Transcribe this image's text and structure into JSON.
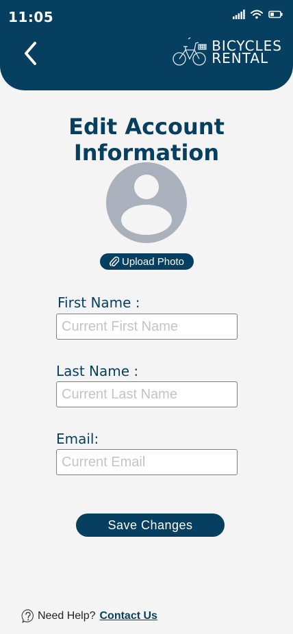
{
  "status_bar": {
    "time": "11:05",
    "icons": [
      "signal-icon",
      "wifi-icon",
      "battery-icon"
    ]
  },
  "header": {
    "back_icon": "chevron-left-icon",
    "logo": {
      "line1": "BICYCLES",
      "line2": "RENTAL",
      "icon": "bicycle-icon"
    }
  },
  "page": {
    "title": "Edit Account Information"
  },
  "avatar": {
    "icon": "user-placeholder-icon"
  },
  "upload": {
    "label": "Upload Photo",
    "icon": "paperclip-icon"
  },
  "form": {
    "first_name": {
      "label": "First Name :",
      "placeholder": "Current First Name",
      "value": ""
    },
    "last_name": {
      "label": "Last Name :",
      "placeholder": "Current Last Name",
      "value": ""
    },
    "email": {
      "label": "Email:",
      "placeholder": "Current Email",
      "value": ""
    }
  },
  "actions": {
    "save_label": "Save Changes"
  },
  "help": {
    "icon": "question-bubble-icon",
    "text": "Need Help?",
    "link": "Contact Us"
  },
  "colors": {
    "primary": "#063f5f",
    "background": "#f4f4f4",
    "avatar": "#aab0bc",
    "placeholder": "#c4c4c4"
  }
}
